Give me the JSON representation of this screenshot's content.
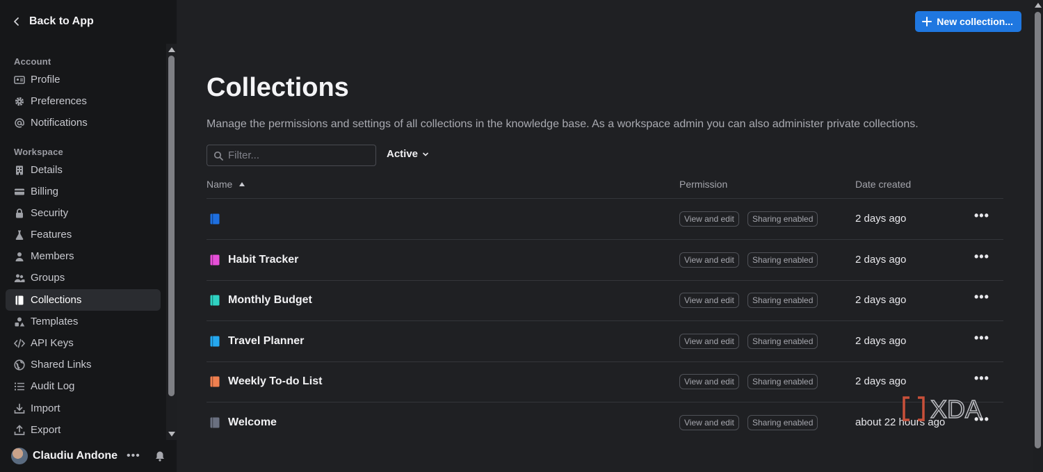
{
  "sidebar": {
    "back_label": "Back to App",
    "account_title": "Account",
    "workspace_title": "Workspace",
    "account_items": [
      {
        "label": "Profile",
        "icon": "profile-icon"
      },
      {
        "label": "Preferences",
        "icon": "gear-icon"
      },
      {
        "label": "Notifications",
        "icon": "at-icon"
      }
    ],
    "workspace_items": [
      {
        "label": "Details",
        "icon": "building-icon"
      },
      {
        "label": "Billing",
        "icon": "card-icon"
      },
      {
        "label": "Security",
        "icon": "padlock-icon"
      },
      {
        "label": "Features",
        "icon": "flask-icon"
      },
      {
        "label": "Members",
        "icon": "user-icon"
      },
      {
        "label": "Groups",
        "icon": "group-icon"
      },
      {
        "label": "Collections",
        "icon": "collection-icon",
        "active": true
      },
      {
        "label": "Templates",
        "icon": "shapes-icon"
      },
      {
        "label": "API Keys",
        "icon": "code-icon"
      },
      {
        "label": "Shared Links",
        "icon": "globe-icon"
      },
      {
        "label": "Audit Log",
        "icon": "list-icon"
      },
      {
        "label": "Import",
        "icon": "import-icon"
      },
      {
        "label": "Export",
        "icon": "export-icon"
      }
    ],
    "user": {
      "name": "Claudiu Andone"
    }
  },
  "header": {
    "new_button_label": "New collection..."
  },
  "main": {
    "title": "Collections",
    "description": "Manage the permissions and settings of all collections in the knowledge base. As a workspace admin you can also administer private collections.",
    "filter_placeholder": "Filter...",
    "status_filter": "Active",
    "columns": {
      "name": "Name",
      "permission": "Permission",
      "date": "Date created"
    },
    "rows": [
      {
        "name": "",
        "color": "#1e6fe0",
        "permission": "View and edit",
        "sharing": "Sharing enabled",
        "date": "2 days ago"
      },
      {
        "name": "Habit Tracker",
        "color": "#e64fd8",
        "permission": "View and edit",
        "sharing": "Sharing enabled",
        "date": "2 days ago"
      },
      {
        "name": "Monthly Budget",
        "color": "#2fd3c3",
        "permission": "View and edit",
        "sharing": "Sharing enabled",
        "date": "2 days ago"
      },
      {
        "name": "Travel Planner",
        "color": "#25a8f0",
        "permission": "View and edit",
        "sharing": "Sharing enabled",
        "date": "2 days ago"
      },
      {
        "name": "Weekly To-do List",
        "color": "#f08050",
        "permission": "View and edit",
        "sharing": "Sharing enabled",
        "date": "2 days ago"
      },
      {
        "name": "Welcome",
        "color": "#6a7080",
        "permission": "View and edit",
        "sharing": "Sharing enabled",
        "date": "about 22 hours ago"
      }
    ]
  },
  "watermark": {
    "text": "XDA"
  }
}
